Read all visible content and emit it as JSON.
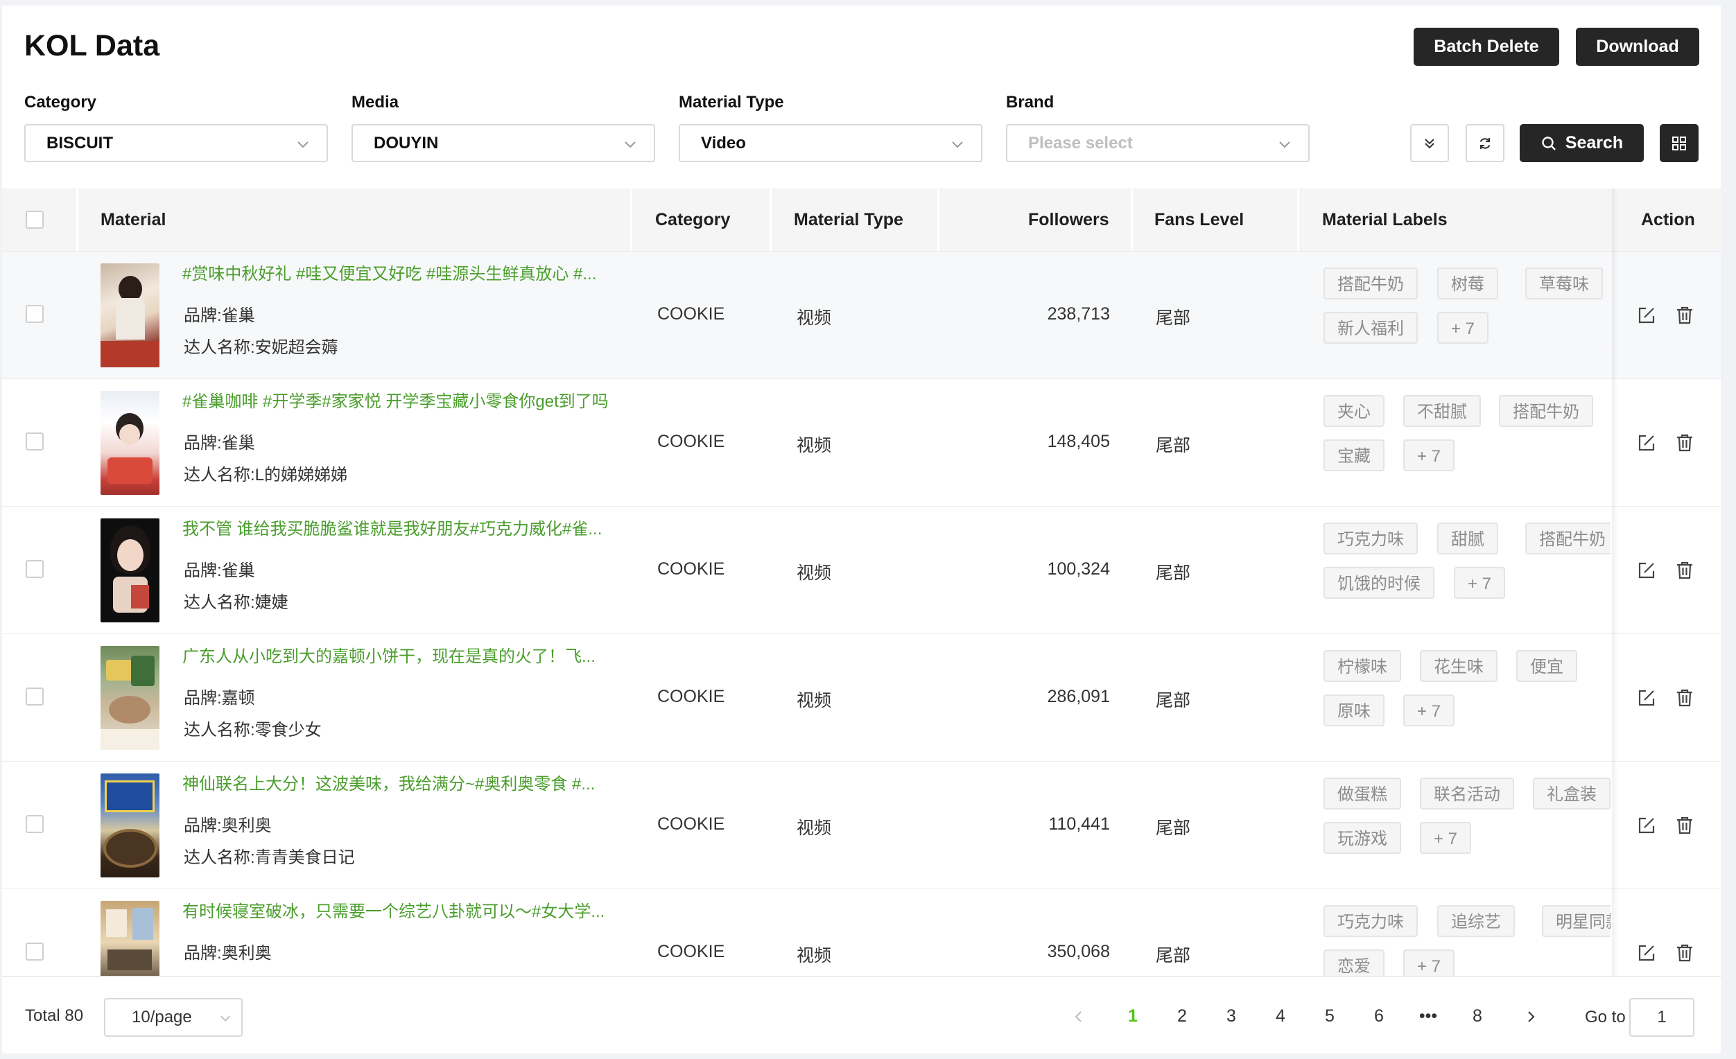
{
  "page_title": "KOL Data",
  "toolbar": {
    "batch_delete": "Batch Delete",
    "download": "Download",
    "search": "Search"
  },
  "filters": {
    "category": {
      "label": "Category",
      "value": "BISCUIT"
    },
    "media": {
      "label": "Media",
      "value": "DOUYIN"
    },
    "material_type": {
      "label": "Material Type",
      "value": "Video"
    },
    "brand": {
      "label": "Brand",
      "placeholder": "Please select"
    }
  },
  "table": {
    "columns": {
      "material": "Material",
      "category": "Category",
      "material_type": "Material Type",
      "followers": "Followers",
      "fans_level": "Fans Level",
      "material_labels": "Material Labels",
      "action": "Action"
    },
    "rows": [
      {
        "title": "#赏味中秋好礼 #哇又便宜又好吃 #哇源头生鲜真放心 #...",
        "brand": "品牌:雀巢",
        "kol": "达人名称:安妮超会薅",
        "category": "COOKIE",
        "type": "视频",
        "followers": "238,713",
        "fans_level": "尾部",
        "tags": [
          "搭配牛奶",
          "树莓",
          "草莓味",
          "新人福利",
          "+ 7"
        ]
      },
      {
        "title": "#雀巢咖啡 #开学季#家家悦 开学季宝藏小零食你get到了吗",
        "brand": "品牌:雀巢",
        "kol": "达人名称:L的娣娣娣娣",
        "category": "COOKIE",
        "type": "视频",
        "followers": "148,405",
        "fans_level": "尾部",
        "tags": [
          "夹心",
          "不甜腻",
          "搭配牛奶",
          "宝藏",
          "+ 7"
        ]
      },
      {
        "title": "我不管 谁给我买脆脆鲨谁就是我好朋友#巧克力威化#雀...",
        "brand": "品牌:雀巢",
        "kol": "达人名称:婕婕",
        "category": "COOKIE",
        "type": "视频",
        "followers": "100,324",
        "fans_level": "尾部",
        "tags": [
          "巧克力味",
          "甜腻",
          "搭配牛奶",
          "饥饿的时候",
          "+ 7"
        ]
      },
      {
        "title": "广东人从小吃到大的嘉顿小饼干，现在是真的火了！飞...",
        "brand": "品牌:嘉顿",
        "kol": "达人名称:零食少女",
        "category": "COOKIE",
        "type": "视频",
        "followers": "286,091",
        "fans_level": "尾部",
        "tags": [
          "柠檬味",
          "花生味",
          "便宜",
          "原味",
          "+ 7"
        ]
      },
      {
        "title": "神仙联名上大分！这波美味，我给满分~#奥利奥零食 #...",
        "brand": "品牌:奥利奥",
        "kol": "达人名称:青青美食日记",
        "category": "COOKIE",
        "type": "视频",
        "followers": "110,441",
        "fans_level": "尾部",
        "tags": [
          "做蛋糕",
          "联名活动",
          "礼盒装",
          "玩游戏",
          "+ 7"
        ]
      },
      {
        "title": "有时候寝室破冰，只需要一个综艺八卦就可以～#女大学...",
        "brand": "品牌:奥利奥",
        "kol": "",
        "category": "COOKIE",
        "type": "视频",
        "followers": "350,068",
        "fans_level": "尾部",
        "tags": [
          "巧克力味",
          "追综艺",
          "明星同款",
          "恋爱",
          "+ 7"
        ]
      }
    ]
  },
  "pagination": {
    "total": "Total 80",
    "page_size": "10/page",
    "pages": [
      "1",
      "2",
      "3",
      "4",
      "5",
      "6",
      "•••",
      "8"
    ],
    "current": "1",
    "goto_label": "Go to",
    "goto_value": "1"
  },
  "colors": {
    "accent_green": "#52c41a",
    "link_green": "#4a9e2c",
    "dark_button": "#262626"
  },
  "icons": [
    "chevron-down-icon",
    "double-chevron-down-icon",
    "refresh-icon",
    "search-icon",
    "grid-icon",
    "edit-icon",
    "delete-icon",
    "chevron-left-icon",
    "chevron-right-icon"
  ]
}
